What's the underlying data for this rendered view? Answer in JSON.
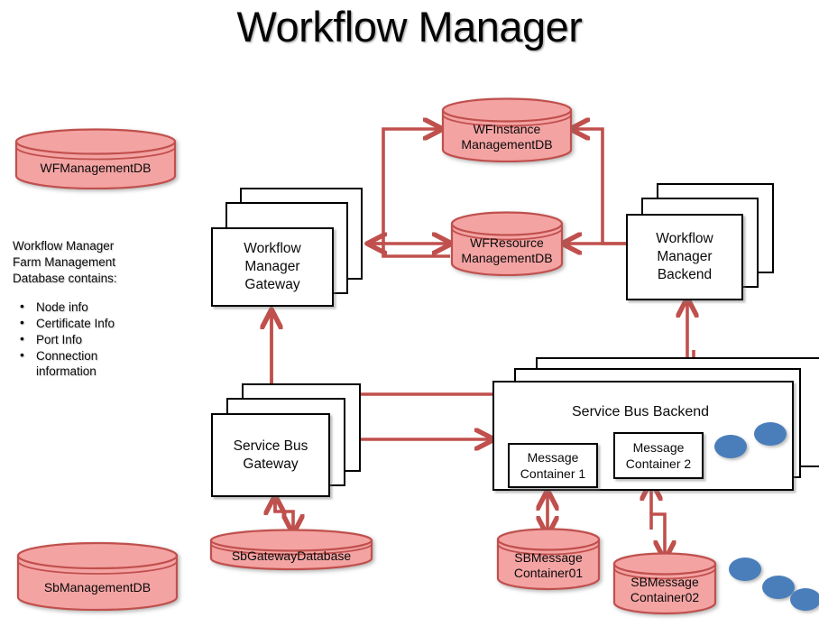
{
  "title": "Workflow Manager",
  "colors": {
    "db_fill": "#f4a3a3",
    "db_stroke": "#c0504d",
    "arrow": "#c0504d",
    "box_stroke": "#000000",
    "dot_fill": "#4a7ebb",
    "dot_stroke": "#2c5185"
  },
  "notes": {
    "lines": [
      "Workflow Manager",
      "Farm Management",
      "Database contains:"
    ],
    "bullets": [
      "Node info",
      "Certificate Info",
      "Port Info",
      "Connection information"
    ]
  },
  "databases": [
    {
      "id": "wf-management-db",
      "label": "WFManagementDB",
      "lines": [
        "WFManagementDB"
      ]
    },
    {
      "id": "wf-instance-management-db",
      "label": "WFInstance ManagementDB",
      "lines": [
        "WFInstance",
        "ManagementDB"
      ]
    },
    {
      "id": "wf-resource-management-db",
      "label": "WFResource ManagementDB",
      "lines": [
        "WFResource",
        "ManagementDB"
      ]
    },
    {
      "id": "sb-gateway-database",
      "label": "SbGatewayDatabase",
      "lines": [
        "SbGatewayDatabase"
      ]
    },
    {
      "id": "sb-message-container-01",
      "label": "SBMessage Container01",
      "lines": [
        "SBMessage",
        "Container01"
      ]
    },
    {
      "id": "sb-message-container-02",
      "label": "SBMessage Container02",
      "lines": [
        "SBMessage",
        "Container02"
      ]
    },
    {
      "id": "sb-management-db",
      "label": "SbManagementDB",
      "lines": [
        "SbManagementDB"
      ]
    }
  ],
  "boxes": {
    "workflow_manager_gateway": {
      "lines": [
        "Workflow",
        "Manager",
        "Gateway"
      ]
    },
    "workflow_manager_backend": {
      "lines": [
        "Workflow",
        "Manager",
        "Backend"
      ]
    },
    "service_bus_gateway": {
      "lines": [
        "Service Bus",
        "Gateway"
      ]
    },
    "service_bus_backend": {
      "title": "Service Bus Backend"
    },
    "message_container_1": {
      "lines": [
        "Message",
        "Container 1"
      ]
    },
    "message_container_2": {
      "lines": [
        "Message",
        "Container 2"
      ]
    }
  },
  "dots": {
    "backend_count": 2,
    "bottom_count": 3
  }
}
